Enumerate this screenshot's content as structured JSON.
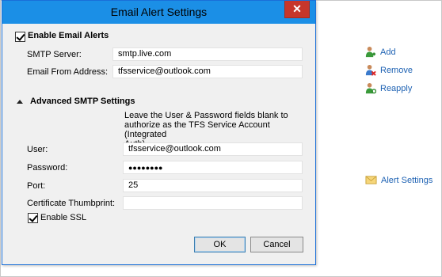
{
  "dialog": {
    "title": "Email Alert Settings",
    "close_glyph": "✕",
    "enable_alerts_label": "Enable Email Alerts",
    "enable_alerts_checked": true,
    "smtp_server_label": "SMTP Server:",
    "smtp_server_value": "smtp.live.com",
    "email_from_label": "Email From Address:",
    "email_from_value": "tfsservice@outlook.com",
    "advanced_header": "Advanced SMTP Settings",
    "note_line1": "Leave the User & Password fields blank to",
    "note_line2": "authorize as the TFS Service Account (Integrated",
    "note_line3": "Auth)",
    "user_label": "User:",
    "user_value": "tfsservice@outlook.com",
    "password_label": "Password:",
    "password_value": "●●●●●●●●",
    "port_label": "Port:",
    "port_value": "25",
    "cert_label": "Certificate Thumbprint:",
    "cert_value": "",
    "enable_ssl_label": "Enable SSL",
    "enable_ssl_checked": true,
    "ok_label": "OK",
    "cancel_label": "Cancel"
  },
  "side_actions": {
    "add": "Add",
    "remove": "Remove",
    "reapply": "Reapply",
    "alert_settings": "Alert Settings"
  },
  "colors": {
    "titlebar": "#1b8fe6",
    "close": "#c7362b",
    "link": "#1e62b3"
  }
}
